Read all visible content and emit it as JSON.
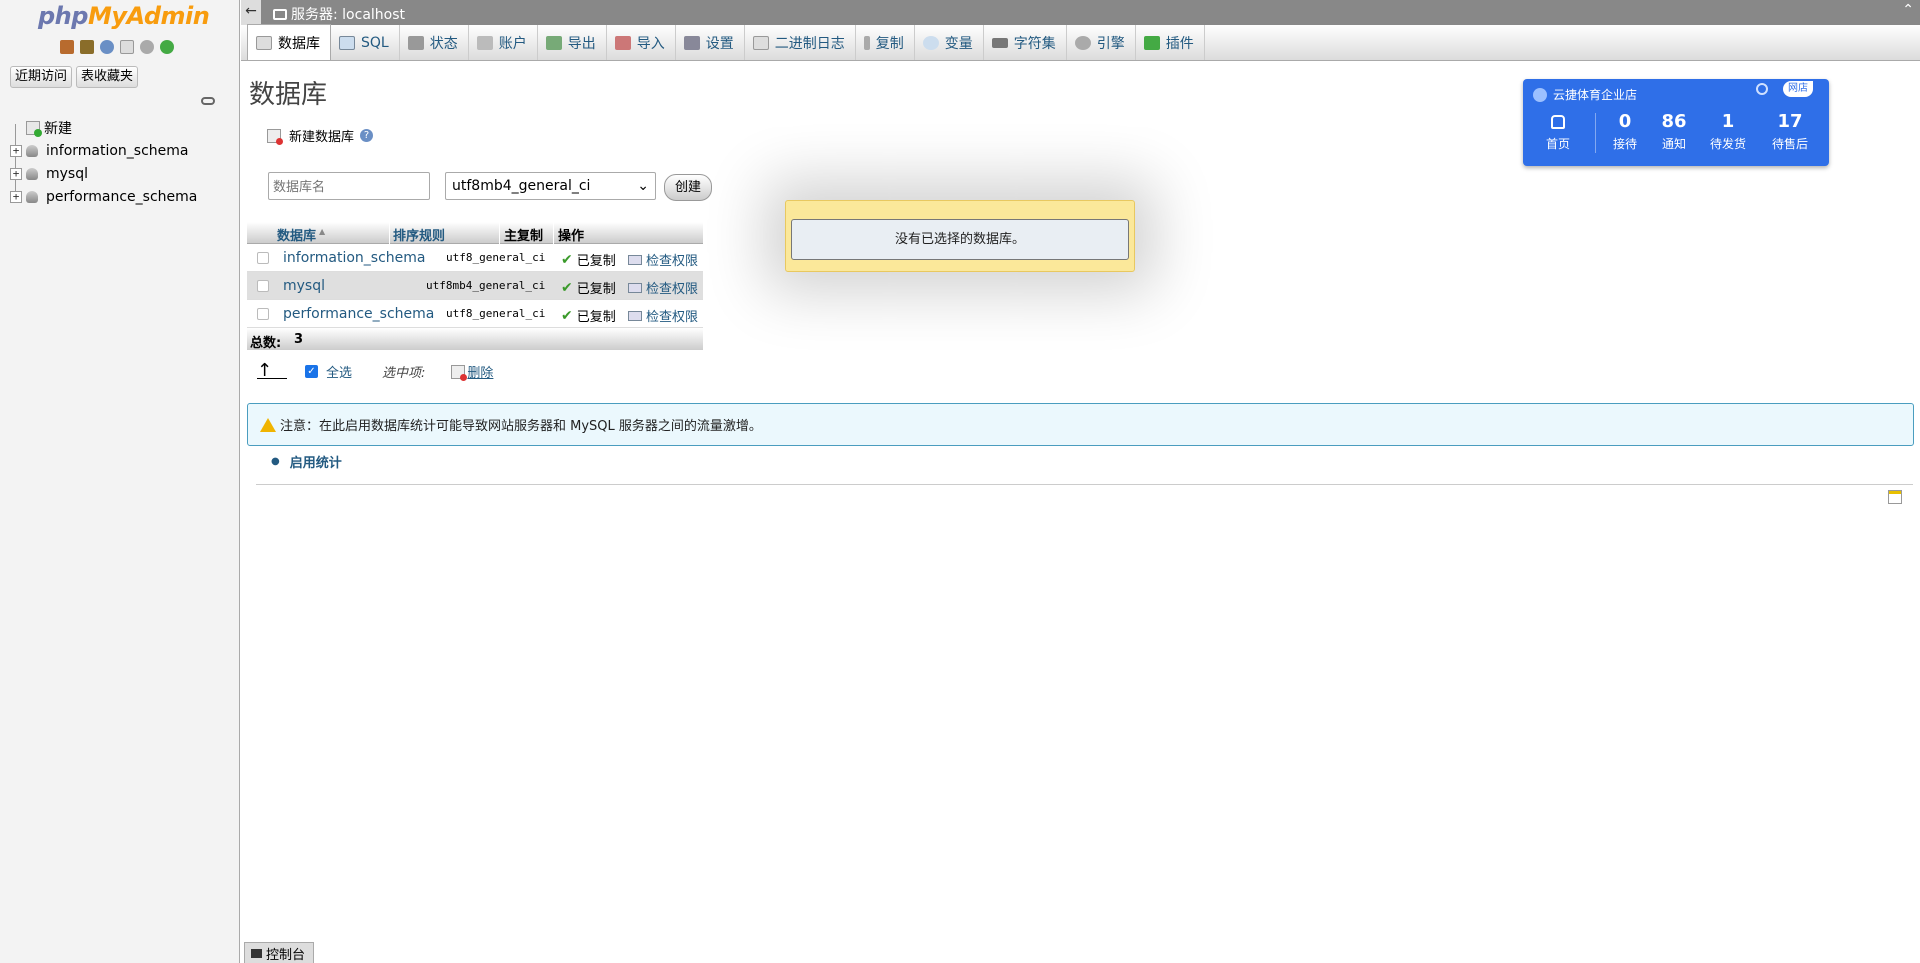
{
  "nav": {
    "logo_php": "php",
    "logo_my": "MyAdmin",
    "recent_button": "近期访问",
    "favorites_button": "表收藏夹",
    "tree": [
      {
        "label": "新建",
        "kind": "new"
      },
      {
        "label": "information_schema",
        "kind": "db"
      },
      {
        "label": "mysql",
        "kind": "db"
      },
      {
        "label": "performance_schema",
        "kind": "db"
      }
    ],
    "icons": [
      "home-icon",
      "db-icon",
      "help-icon",
      "doc-icon",
      "settings-icon",
      "reload-icon"
    ]
  },
  "serverbar": {
    "collapse": "←",
    "server_label": "服务器: localhost",
    "maximize": "⌃"
  },
  "menu": {
    "tabs": [
      {
        "label": "数据库",
        "icon": "database-icon",
        "active": true
      },
      {
        "label": "SQL",
        "icon": "sql-icon"
      },
      {
        "label": "状态",
        "icon": "status-icon"
      },
      {
        "label": "账户",
        "icon": "accounts-icon"
      },
      {
        "label": "导出",
        "icon": "export-icon"
      },
      {
        "label": "导入",
        "icon": "import-icon"
      },
      {
        "label": "设置",
        "icon": "settings-icon"
      },
      {
        "label": "二进制日志",
        "icon": "binlog-icon"
      },
      {
        "label": "复制",
        "icon": "replication-icon"
      },
      {
        "label": "变量",
        "icon": "variables-icon"
      },
      {
        "label": "字符集",
        "icon": "charset-icon"
      },
      {
        "label": "引擎",
        "icon": "engine-icon"
      },
      {
        "label": "插件",
        "icon": "plugin-icon"
      }
    ]
  },
  "main": {
    "title": "数据库",
    "new_db_label": "新建数据库",
    "db_name_placeholder": "数据库名",
    "collation_value": "utf8mb4_general_ci",
    "create_button": "创建",
    "table": {
      "headers": {
        "database": "数据库",
        "collation": "排序规则",
        "replication": "主复制",
        "action": "操作"
      },
      "rows": [
        {
          "name": "information_schema",
          "collation": "utf8_general_ci",
          "replication": "已复制",
          "action": "检查权限"
        },
        {
          "name": "mysql",
          "collation": "utf8mb4_general_ci",
          "replication": "已复制",
          "action": "检查权限"
        },
        {
          "name": "performance_schema",
          "collation": "utf8_general_ci",
          "replication": "已复制",
          "action": "检查权限"
        }
      ],
      "total_label": "总数:",
      "total_value": "3"
    },
    "select_all": "全选",
    "with_selected": "选中项:",
    "delete": "删除",
    "notice": "注意：在此启用数据库统计可能导致网站服务器和 MySQL 服务器之间的流量激增。",
    "enable_stats": "启用统计"
  },
  "dialog": {
    "message": "没有已选择的数据库。"
  },
  "widget": {
    "shop_name": "云捷体育企业店",
    "store_badge": "网店",
    "home_label": "首页",
    "stats": [
      {
        "value": "0",
        "label": "接待"
      },
      {
        "value": "86",
        "label": "通知"
      },
      {
        "value": "1",
        "label": "待发货"
      },
      {
        "value": "17",
        "label": "待售后"
      }
    ]
  },
  "console": {
    "label": "控制台"
  },
  "colors": {
    "accent": "#235a81",
    "widget_blue": "#2f6fe8",
    "dialog_yellow": "#fbe89a"
  }
}
